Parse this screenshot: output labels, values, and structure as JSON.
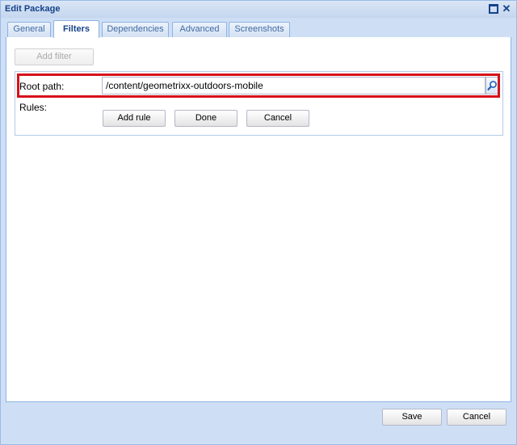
{
  "window": {
    "title": "Edit Package",
    "tools": [
      "maximize-icon",
      "close-icon"
    ],
    "close_glyph": "✕"
  },
  "tabs": [
    {
      "label": "General",
      "active": false
    },
    {
      "label": "Filters",
      "active": true
    },
    {
      "label": "Dependencies",
      "active": false
    },
    {
      "label": "Advanced",
      "active": false
    },
    {
      "label": "Screenshots",
      "active": false
    }
  ],
  "filters": {
    "add_filter_label": "Add filter",
    "add_filter_disabled": true,
    "root_path_label": "Root path:",
    "root_path_value": "/content/geometrixx-outdoors-mobile",
    "search_icon": "search-icon",
    "rules_label": "Rules:",
    "add_rule_label": "Add rule",
    "done_label": "Done",
    "cancel_label": "Cancel"
  },
  "footer": {
    "save_label": "Save",
    "cancel_label": "Cancel"
  },
  "colors": {
    "highlight": "#d6121a",
    "title_text": "#15428b",
    "frame": "#cedff5"
  }
}
